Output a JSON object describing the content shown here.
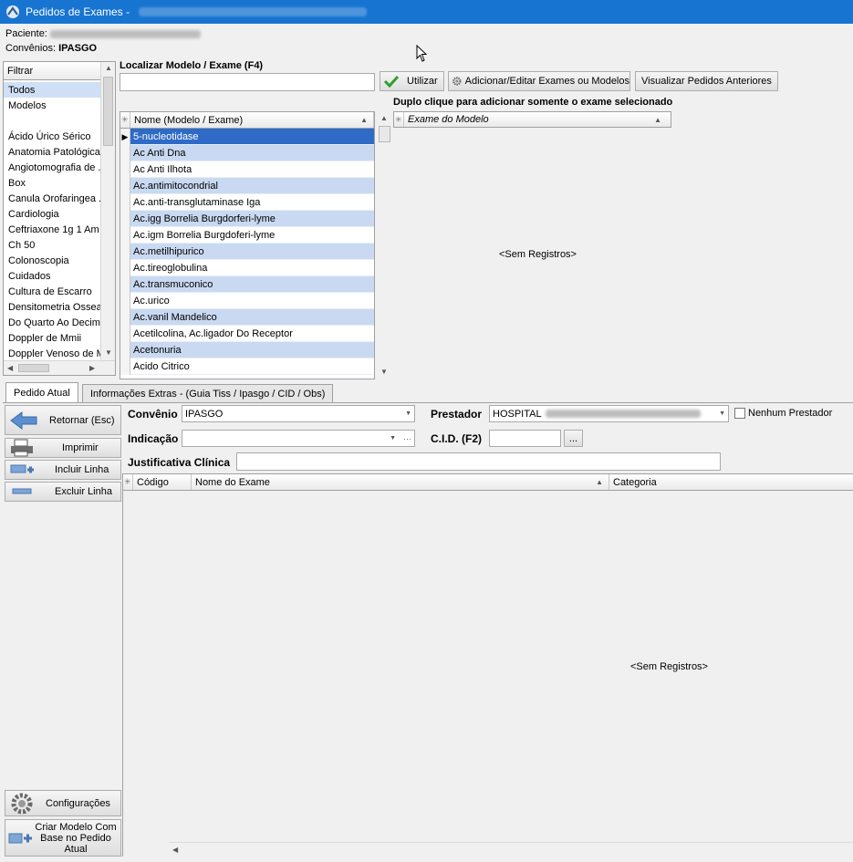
{
  "window": {
    "title": "Pedidos de Exames -"
  },
  "patient": {
    "label": "Paciente:",
    "convenios_label": "Convênios:",
    "convenios_value": "IPASGO"
  },
  "filter": {
    "header": "Filtrar",
    "items": [
      "Todos",
      "Modelos",
      "",
      "Ácido Úrico Sérico",
      "Anatomia Patológica",
      "Angiotomografia de .",
      "Box",
      "Canula Orofaringea .",
      "Cardiologia",
      "Ceftriaxone 1g 1 Am",
      "Ch 50",
      "Colonoscopia",
      "Cuidados",
      "Cultura de Escarro",
      "Densitometria Ossea",
      "Do Quarto Ao Decim.",
      "Doppler de Mmii",
      "Doppler Venoso de M"
    ]
  },
  "search": {
    "label": "Localizar Modelo / Exame (F4)",
    "value": "",
    "utilizar_label": "Utilizar",
    "add_edit_label": "Adicionar/Editar Exames ou Modelos",
    "previous_label": "Visualizar Pedidos Anteriores"
  },
  "models_grid": {
    "header": "Nome (Modelo / Exame)",
    "rows": [
      "5-nucleotidase",
      "Ac Anti Dna",
      "Ac Anti Ilhota",
      "Ac.antimitocondrial",
      "Ac.anti-transglutaminase Iga",
      "Ac.igg Borrelia Burgdorferi-lyme",
      "Ac.igm Borrelia Burgdoferi-lyme",
      "Ac.metilhipurico",
      "Ac.tireoglobulina",
      "Ac.transmuconico",
      "Ac.urico",
      "Ac.vanil Mandelico",
      "Acetilcolina, Ac.ligador Do Receptor",
      "Acetonuria",
      "Acido Citrico"
    ]
  },
  "model_exams": {
    "hint": "Duplo clique para adicionar somente o exame selecionado",
    "header": "Exame do Modelo",
    "empty": "<Sem Registros>"
  },
  "tabs": [
    "Pedido Atual",
    "Informações Extras -  (Guia Tiss / Ipasgo / CID / Obs)"
  ],
  "side_buttons": {
    "retornar": "Retornar (Esc)",
    "imprimir": "Imprimir",
    "incluir": "Incluir Linha",
    "excluir": "Excluir Linha",
    "config": "Configurações",
    "criar": "Criar Modelo Com Base no Pedido Atual"
  },
  "form": {
    "convenio_label": "Convênio",
    "convenio_value": "IPASGO",
    "prestador_label": "Prestador",
    "prestador_value": "HOSPITAL",
    "nenhum_label": "Nenhum Prestador",
    "indicacao_label": "Indicação",
    "indicacao_value": "",
    "cid_label": "C.I.D. (F2)",
    "cid_value": "",
    "cid_button": "...",
    "justificativa_label": "Justificativa Clínica",
    "justificativa_value": ""
  },
  "order_grid": {
    "columns": [
      "Código",
      "Nome do Exame",
      "Categoria"
    ],
    "empty": "<Sem Registros>"
  },
  "colors": {
    "title_bar": "#1874d1",
    "selected_row": "#2f6bc6",
    "alt_row": "#c9d9f1",
    "check_green": "#2ca02c"
  }
}
